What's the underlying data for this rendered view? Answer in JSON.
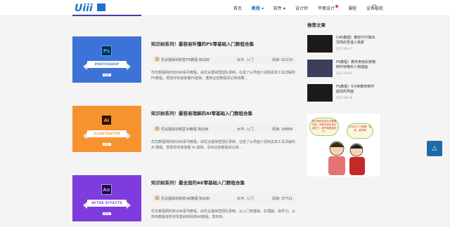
{
  "nav": {
    "items": [
      "首页",
      "教程",
      "软件",
      "设计师",
      "平面设计",
      "课程",
      "设计导航"
    ],
    "active": "教程",
    "dropdown_items": [
      "教程",
      "软件"
    ],
    "dot_item": "平面设计"
  },
  "logo": {
    "text": "Uiii",
    "color": "#1b73c7"
  },
  "articles": [
    {
      "title": "知识树系列！最容易听懂的PS零基础入门教程合集",
      "badge": "Ps",
      "ribbon": "PHOTOSHOP",
      "free": "FREE",
      "author": "优设基础训练营",
      "category": "PS教程  知识树",
      "level": "水平: 入门",
      "reads": "阅读: 62133",
      "desc": "优优教程网的知识树系列教程，由优设基础营团队录制，在逐了从界面介绍到具体工具详解的PS教程，帮助你快速掌握PS基础。重新这些教程请记得收藏...",
      "color": "#3d73d8",
      "badge_color": "#3fa9f5"
    },
    {
      "title": "知识树系列！最容易理解的AI零基础入门教程合集",
      "badge": "Ai",
      "ribbon": "ILLUSTRATOR",
      "free": "FREE",
      "author": "优设基础训练营",
      "category": "AI教程  知识树",
      "level": "水平: 入门",
      "reads": "阅读: 39884",
      "desc": "优优教程网的知识树系列教程，由优设基础营团队录制，在逐了从界面介绍到具体工具详解的 AI 教程，帮助你快速掌握 AI 基础。喜欢这些教程请记得...",
      "color": "#f7932f",
      "badge_color": "#f7932f"
    },
    {
      "title": "知识树系列！最全面的AE零基础入门教程合集",
      "badge": "Ae",
      "ribbon": "AFTER EFFECTS",
      "free": "FREE",
      "author": "优设基础训练营",
      "category": "AE教程  知识树",
      "level": "水平: 入门",
      "reads": "阅读: 37721",
      "desc": "优优教程网的知识树系列教程，由优设基础营团队录制。从入门到基础，好理解，易学习。从简单教程进阶到零基础到经典AE教程，帮你快...",
      "color": "#7e3cde",
      "badge_color": "#b28cff"
    }
  ],
  "sidebar": {
    "title": "推荐文章",
    "items": [
      {
        "title": "C4D教程！教你叮叮做出漂亮的圣诞小场景",
        "date": "2017-09-27"
      },
      {
        "title": "PS教程！教你用色彩鲜艳制作惊艳的人物插画",
        "date": "2017-09-05"
      },
      {
        "title": "PS教程！5分钟教你制作超炫的界面",
        "date": "2017-09-16"
      }
    ],
    "comic_text1": "设计师你们的水平都差不多，好的作品你设计出来了，那不就是我的了？",
    "comic_text2": "什么吐了个的嘛！哈哈，就好啊"
  },
  "back_to_top": "△"
}
